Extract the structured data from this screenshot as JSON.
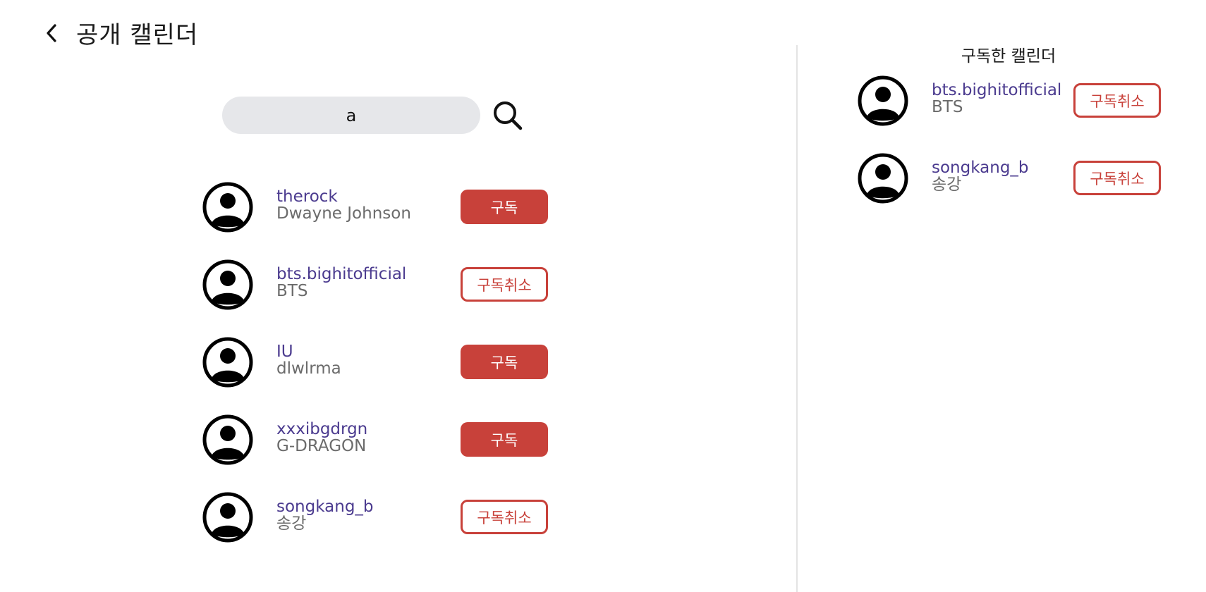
{
  "header": {
    "back_icon": "chevron-left-icon",
    "title": "공개 캘린더"
  },
  "search": {
    "value": "a",
    "icon": "search-icon"
  },
  "results": [
    {
      "id": "therock",
      "name": "Dwayne Johnson",
      "button": "구독",
      "state": "subscribe"
    },
    {
      "id": "bts.bighitofficial",
      "name": "BTS",
      "button": "구독취소",
      "state": "unsubscribe"
    },
    {
      "id": "IU",
      "name": "dlwlrma",
      "button": "구독",
      "state": "subscribe"
    },
    {
      "id": "xxxibgdrgn",
      "name": "G-DRAGON",
      "button": "구독",
      "state": "subscribe"
    },
    {
      "id": "songkang_b",
      "name": "송강",
      "button": "구독취소",
      "state": "unsubscribe"
    }
  ],
  "subscribed_panel": {
    "title": "구독한 캘린더",
    "items": [
      {
        "id": "bts.bighitofficial",
        "name": "BTS",
        "button": "구독취소"
      },
      {
        "id": "songkang_b",
        "name": "송강",
        "button": "구독취소"
      }
    ]
  },
  "colors": {
    "accent": "#c8413a",
    "user_id": "#4b3b8f",
    "user_name": "#6b6b6b",
    "search_bg": "#e6e7ea"
  }
}
